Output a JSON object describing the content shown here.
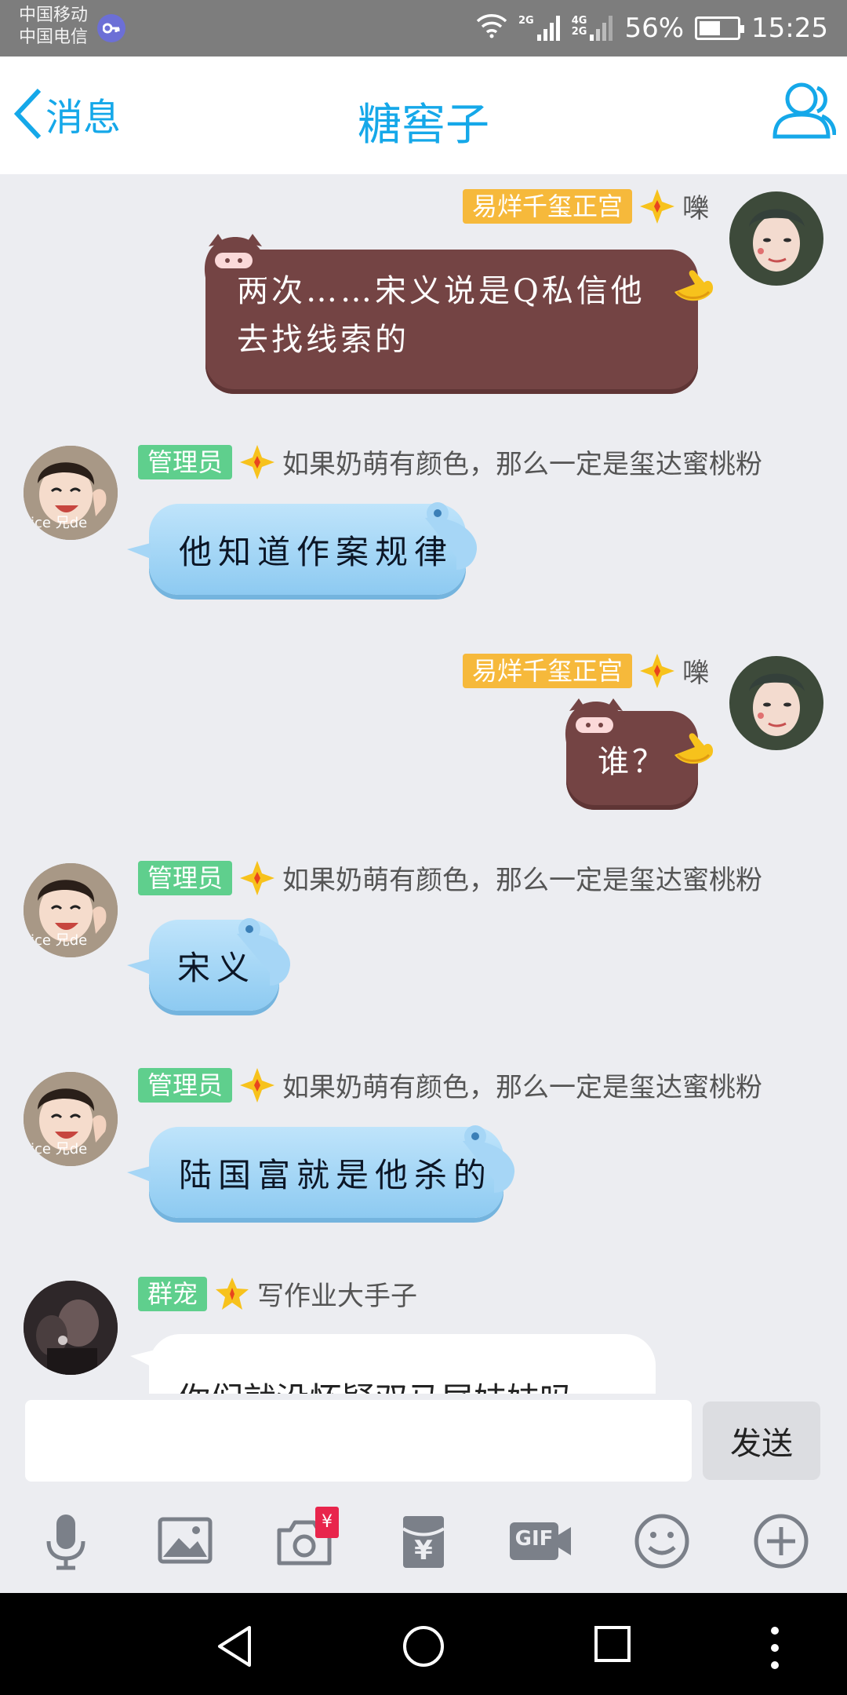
{
  "status_bar": {
    "carrier_1": "中国移动",
    "carrier_2": "中国电信",
    "network_1": "2G",
    "network_2_top": "4G",
    "network_2_bottom": "2G",
    "battery_percent": "56%",
    "battery_level": 0.56,
    "time": "15:25"
  },
  "header": {
    "back_label": "消息",
    "title": "糖窖子"
  },
  "messages": [
    {
      "side": "right",
      "badge": "易烊千玺正宫",
      "name": "嚛",
      "text": "两次……宋义说是Q私信他去找线索的"
    },
    {
      "side": "left",
      "badge": "管理员",
      "name": "如果奶萌有颜色，那么一定是玺达蜜桃粉",
      "text": "他知道作案规律",
      "avatar_caption": "Alice 兄dei"
    },
    {
      "side": "right",
      "badge": "易烊千玺正宫",
      "name": "嚛",
      "text": "谁？"
    },
    {
      "side": "left",
      "badge": "管理员",
      "name": "如果奶萌有颜色，那么一定是玺达蜜桃粉",
      "text": "宋义",
      "avatar_caption": "Alice 兄dei"
    },
    {
      "side": "left",
      "badge": "管理员",
      "name": "如果奶萌有颜色，那么一定是玺达蜜桃粉",
      "text": "陆国富就是他杀的",
      "avatar_caption": "Alice 兄dei"
    },
    {
      "side": "left",
      "badge": "群宠",
      "name": "写作业大手子",
      "text": "你们就没怀疑双马尾妹妹吗"
    }
  ],
  "input": {
    "placeholder": "",
    "send_label": "发送"
  },
  "toolbar": {
    "icons": [
      "microphone-icon",
      "image-icon",
      "camera-icon",
      "red-packet-icon",
      "gif-icon",
      "emoji-icon",
      "plus-icon"
    ],
    "camera_badge": "¥",
    "red_packet_symbol": "¥",
    "gif_label": "GIF"
  },
  "colors": {
    "accent": "#15a8e9",
    "brown_bubble": "#744444",
    "blue_bubble": "#9dd3f5",
    "gold_badge": "#f6b93b",
    "green_badge": "#5fcf8d"
  }
}
